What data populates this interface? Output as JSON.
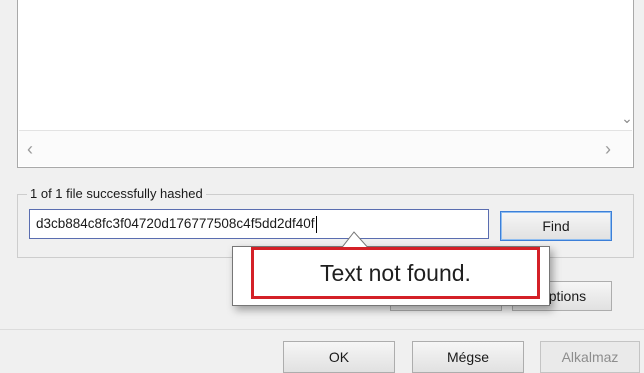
{
  "results": {
    "scroll_left_icon": "chevron-left-icon",
    "scroll_right_icon": "chevron-right-icon",
    "scroll_down_icon": "chevron-down-icon"
  },
  "hash_group": {
    "legend": "1 of 1 file successfully hashed",
    "hash_value": "d3cb884c8fc3f04720d176777508c4f5dd2df40f",
    "find_label": "Find",
    "options_label": "Options"
  },
  "tooltip": {
    "message": "Text not found.",
    "highlight_color": "#d42027"
  },
  "footer": {
    "ok_label": "OK",
    "cancel_label": "Mégse",
    "apply_label": "Alkalmaz"
  }
}
